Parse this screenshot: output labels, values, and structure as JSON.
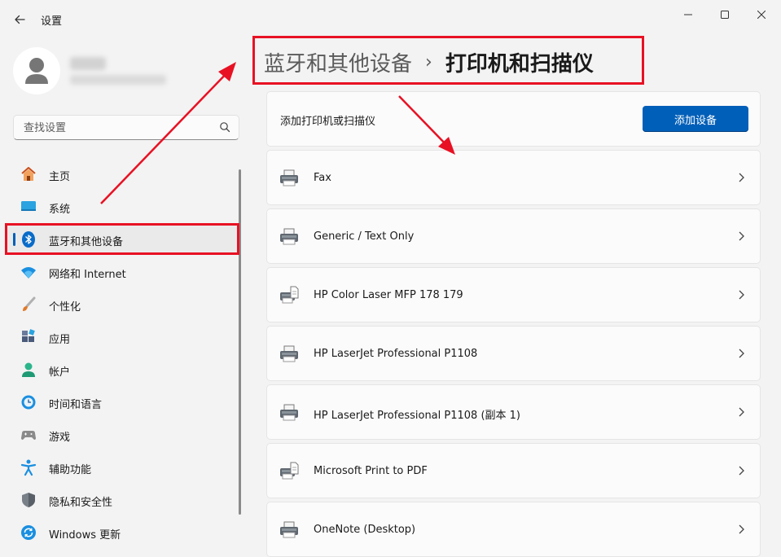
{
  "app": {
    "title": "设置"
  },
  "search": {
    "placeholder": "查找设置"
  },
  "nav": {
    "items": [
      {
        "label": "主页",
        "icon": "home-icon"
      },
      {
        "label": "系统",
        "icon": "system-icon"
      },
      {
        "label": "蓝牙和其他设备",
        "icon": "bluetooth-icon",
        "selected": true
      },
      {
        "label": "网络和 Internet",
        "icon": "wifi-icon"
      },
      {
        "label": "个性化",
        "icon": "brush-icon"
      },
      {
        "label": "应用",
        "icon": "apps-icon"
      },
      {
        "label": "帐户",
        "icon": "account-icon"
      },
      {
        "label": "时间和语言",
        "icon": "clock-globe-icon"
      },
      {
        "label": "游戏",
        "icon": "gamepad-icon"
      },
      {
        "label": "辅助功能",
        "icon": "accessibility-icon"
      },
      {
        "label": "隐私和安全性",
        "icon": "shield-icon"
      },
      {
        "label": "Windows 更新",
        "icon": "update-icon"
      }
    ]
  },
  "breadcrumb": {
    "parent": "蓝牙和其他设备",
    "separator": "›",
    "current": "打印机和扫描仪"
  },
  "add_section": {
    "label": "添加打印机或扫描仪",
    "button": "添加设备"
  },
  "printers": [
    {
      "name": "Fax",
      "icon": "printer-icon"
    },
    {
      "name": "Generic / Text Only",
      "icon": "printer-icon"
    },
    {
      "name": "HP Color Laser MFP 178 179",
      "icon": "printer-document-icon"
    },
    {
      "name": "HP LaserJet Professional P1108",
      "icon": "printer-icon"
    },
    {
      "name": "HP LaserJet Professional P1108 (副本 1)",
      "icon": "printer-icon"
    },
    {
      "name": "Microsoft Print to PDF",
      "icon": "printer-document-icon"
    },
    {
      "name": "OneNote (Desktop)",
      "icon": "printer-icon"
    }
  ],
  "colors": {
    "accent": "#005fb8",
    "annotation": "#e81123",
    "window_bg": "#f3f3f3",
    "card_bg": "#fbfbfb"
  }
}
